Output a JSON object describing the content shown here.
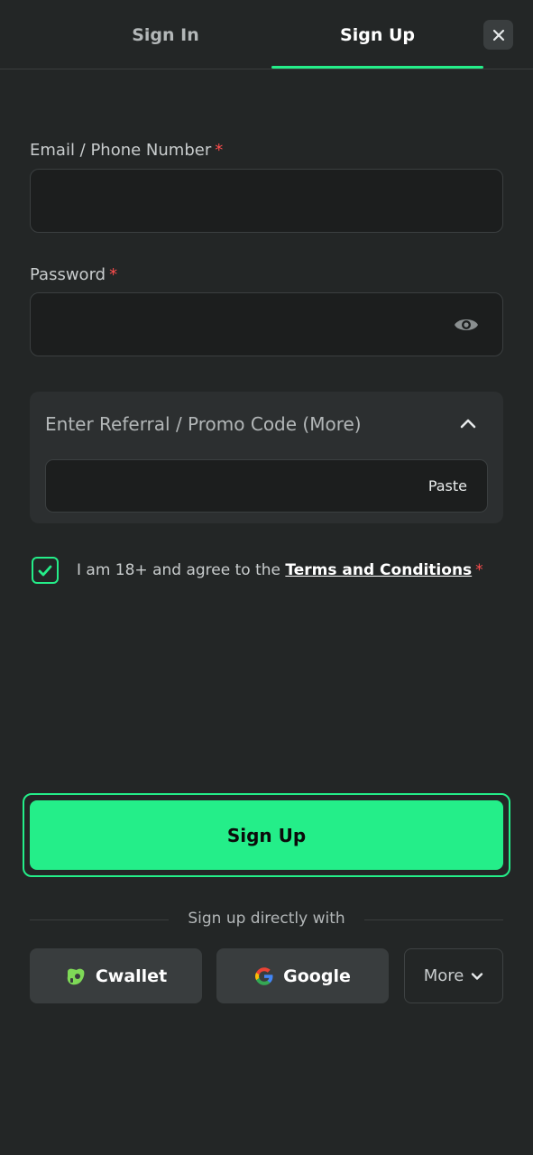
{
  "tabs": {
    "sign_in": "Sign In",
    "sign_up": "Sign Up"
  },
  "form": {
    "email_label": "Email / Phone Number",
    "email_value": "",
    "password_label": "Password",
    "password_value": "",
    "required_mark": "*",
    "promo_title": "Enter Referral / Promo Code (More)",
    "promo_value": "",
    "paste_label": "Paste",
    "agree_text": "I am 18+ and agree to the",
    "terms_link": "Terms and Conditions",
    "agree_checked": true
  },
  "actions": {
    "signup_button": "Sign Up"
  },
  "social": {
    "divider_text": "Sign up directly with",
    "cwallet": "Cwallet",
    "google": "Google",
    "more": "More"
  },
  "colors": {
    "accent": "#24ee89",
    "background": "#232626",
    "required": "#ff4d4d"
  }
}
